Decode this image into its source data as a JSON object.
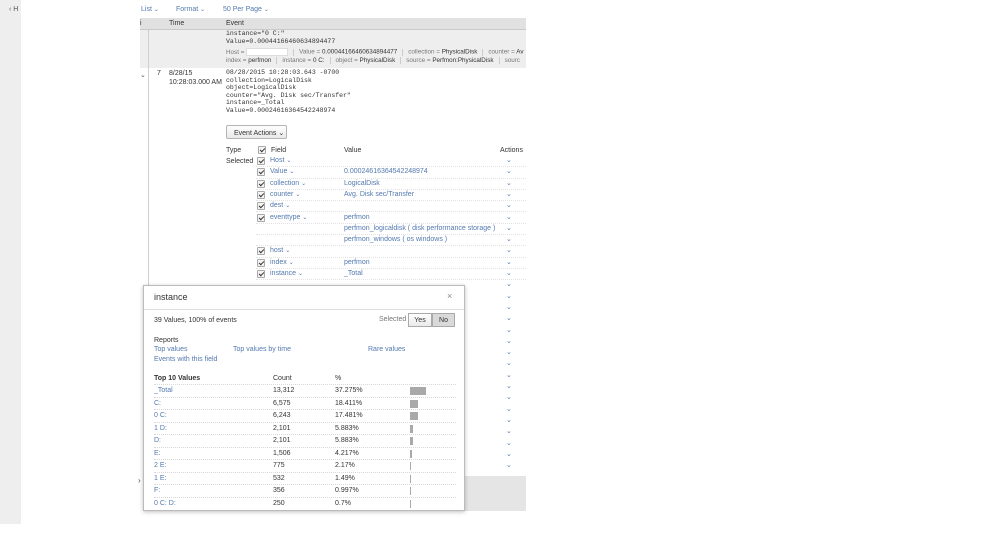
{
  "nav": {
    "back_label": "H"
  },
  "toolbar": {
    "list": "List",
    "format": "Format",
    "per_page": "50 Per Page",
    "caret": "⌄"
  },
  "columns": {
    "index": "i",
    "time": "Time",
    "event": "Event"
  },
  "prev_event": {
    "raw": "instance=\"0 C:\"\nValue=0.00044166460634894477",
    "line1": [
      {
        "k": "Host = ",
        "v": ""
      },
      {
        "k": "Value = ",
        "v": "0.00044166460634894477"
      },
      {
        "k": "collection = ",
        "v": "PhysicalDisk"
      },
      {
        "k": "counter = ",
        "v": "Av"
      }
    ],
    "line2": [
      {
        "k": "index = ",
        "v": "perfmon"
      },
      {
        "k": "instance = ",
        "v": "0 C:"
      },
      {
        "k": "object = ",
        "v": "PhysicalDisk"
      },
      {
        "k": "source = ",
        "v": "Perfmon:PhysicalDisk"
      },
      {
        "k": "sourc",
        "v": ""
      }
    ]
  },
  "event": {
    "toggle": "⌄",
    "number": "7",
    "date": "8/28/15",
    "time": "10:28:03.000 AM",
    "raw": "08/28/2015 10:28:03.643 -0700\ncollection=LogicalDisk\nobject=LogicalDisk\ncounter=\"Avg. Disk sec/Transfer\"\ninstance=_Total\nValue=0.00024616364542248974",
    "actions_button": "Event Actions ⌄"
  },
  "fields_table": {
    "type_header": "Type",
    "field_header": "Field",
    "value_header": "Value",
    "actions_header": "Actions",
    "selected_label": "Selected",
    "action_caret": "⌄",
    "rows": [
      {
        "checked": true,
        "name": "Host",
        "value": ""
      },
      {
        "checked": true,
        "name": "Value",
        "value": "0.00024616364542248974"
      },
      {
        "checked": true,
        "name": "collection",
        "value": "LogicalDisk"
      },
      {
        "checked": true,
        "name": "counter",
        "value": "Avg. Disk sec/Transfer"
      },
      {
        "checked": true,
        "name": "dest",
        "value": ""
      },
      {
        "checked": true,
        "name": "eventtype",
        "value": "perfmon"
      },
      {
        "checked": false,
        "name": "",
        "value": "perfmon_logicaldisk  ( disk  performance  storage )"
      },
      {
        "checked": false,
        "name": "",
        "value": "perfmon_windows  ( os   windows )"
      },
      {
        "checked": true,
        "name": "host",
        "value": ""
      },
      {
        "checked": true,
        "name": "index",
        "value": "perfmon"
      },
      {
        "checked": true,
        "name": "instance",
        "value": "_Total"
      }
    ]
  },
  "popup": {
    "title": "instance",
    "close": "×",
    "summary": "39 Values, 100% of events",
    "selected_label": "Selected",
    "yes": "Yes",
    "no": "No",
    "reports_heading": "Reports",
    "top_values": "Top values",
    "top_values_by_time": "Top values by time",
    "rare_values": "Rare values",
    "events_with_field": "Events with this field",
    "top10_heading": "Top 10 Values",
    "count_heading": "Count",
    "pct_heading": "%",
    "values": [
      {
        "name": "_Total",
        "count": "13,312",
        "pct": "37.275%",
        "fraction": 0.37275
      },
      {
        "name": "C:",
        "count": "6,575",
        "pct": "18.411%",
        "fraction": 0.18411
      },
      {
        "name": "0 C:",
        "count": "6,243",
        "pct": "17.481%",
        "fraction": 0.17481
      },
      {
        "name": "1 D:",
        "count": "2,101",
        "pct": "5.883%",
        "fraction": 0.05883
      },
      {
        "name": "D:",
        "count": "2,101",
        "pct": "5.883%",
        "fraction": 0.05883
      },
      {
        "name": "E:",
        "count": "1,506",
        "pct": "4.217%",
        "fraction": 0.04217
      },
      {
        "name": "2 E:",
        "count": "775",
        "pct": "2.17%",
        "fraction": 0.0217
      },
      {
        "name": "1 E:",
        "count": "532",
        "pct": "1.49%",
        "fraction": 0.0149
      },
      {
        "name": "F:",
        "count": "356",
        "pct": "0.997%",
        "fraction": 0.00997
      },
      {
        "name": "0 C: D:",
        "count": "250",
        "pct": "0.7%",
        "fraction": 0.007
      }
    ]
  }
}
